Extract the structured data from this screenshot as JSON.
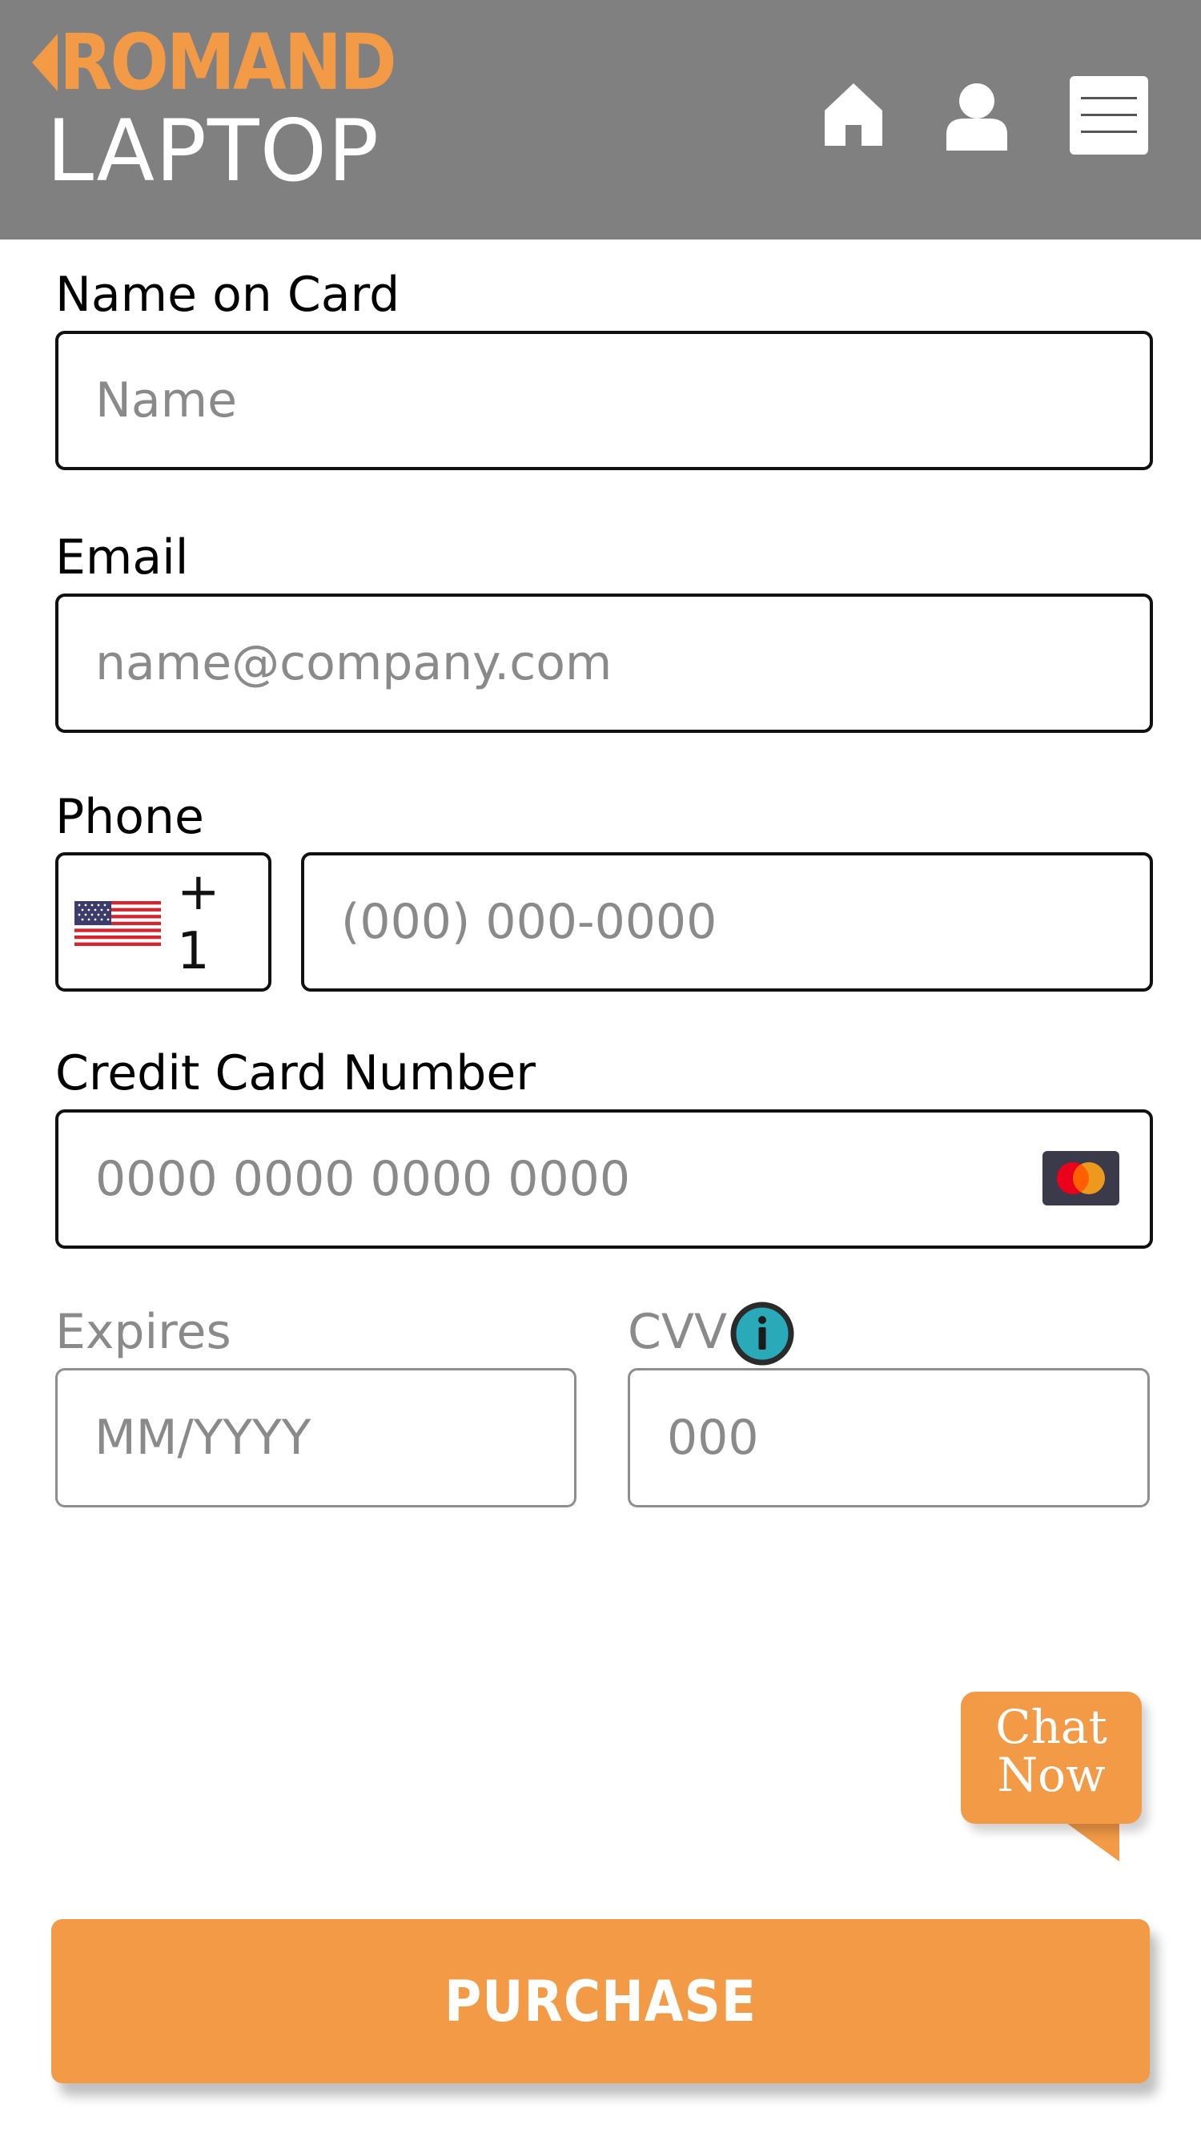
{
  "header": {
    "logo_brand": "ROMAND",
    "logo_product": "LAPTOP",
    "icons": [
      "home-icon",
      "user-icon",
      "menu-icon"
    ]
  },
  "form": {
    "name": {
      "label": "Name on Card",
      "placeholder": "Name"
    },
    "email": {
      "label": "Email",
      "placeholder": "name@company.com"
    },
    "phone": {
      "label": "Phone",
      "country_code": "+ 1",
      "flag": "us-flag-icon",
      "placeholder": "(000) 000-0000"
    },
    "card": {
      "label": "Credit Card Number",
      "placeholder": "0000 0000 0000 0000",
      "brand_icon": "mastercard-icon"
    },
    "expires": {
      "label": "Expires",
      "placeholder": "MM/YYYY"
    },
    "cvv": {
      "label": "CVV",
      "placeholder": "000",
      "info_icon": "info-icon"
    }
  },
  "chat": {
    "label_line1": "Chat",
    "label_line2": "Now"
  },
  "purchase": {
    "label": "PURCHASE"
  },
  "colors": {
    "header_bg": "#808080",
    "accent": "#f29a45",
    "info_teal": "#2aa9b8"
  }
}
